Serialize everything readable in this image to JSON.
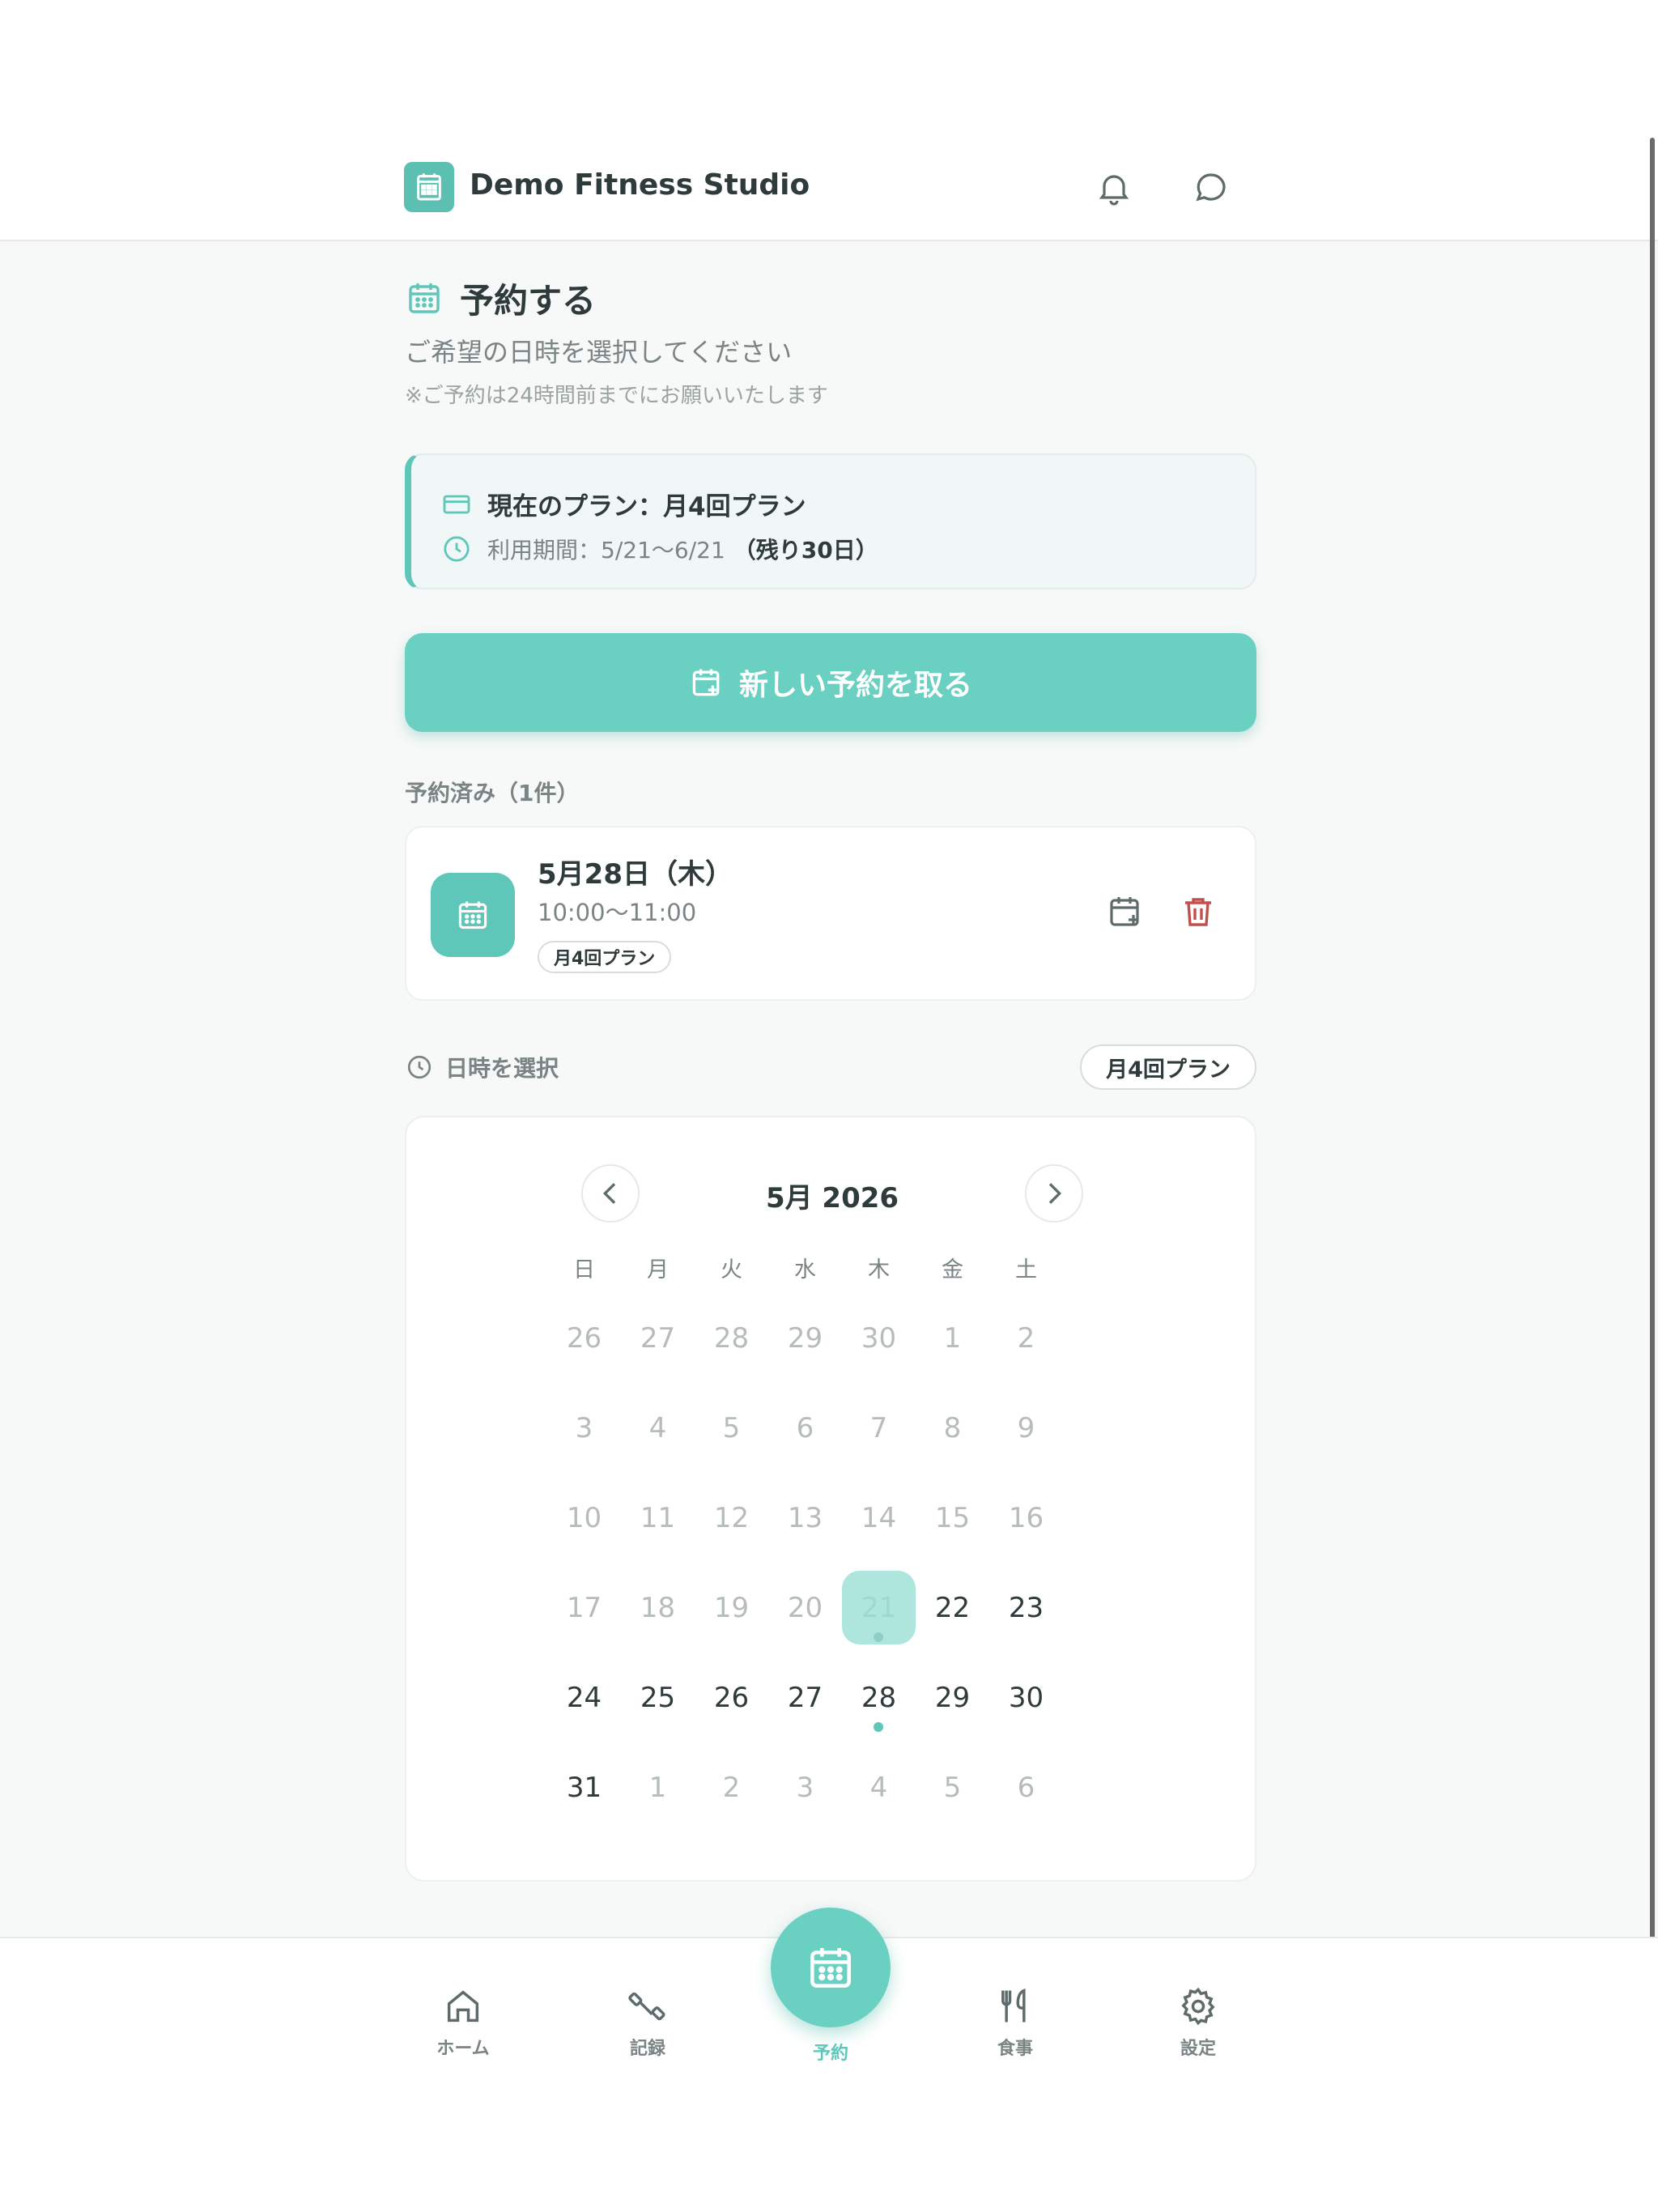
{
  "header": {
    "brand": "Demo Fitness Studio",
    "icons": [
      "bell-icon",
      "chat-icon"
    ]
  },
  "page": {
    "title": "予約する",
    "subtitle": "ご希望の日時を選択してください",
    "note": "※ご予約は24時間前までにお願いいたします"
  },
  "plan": {
    "name": "現在のプラン：月4回プラン",
    "period": "利用期間：5/21〜6/21",
    "remaining": "（残り30日）"
  },
  "new_booking_label": "新しい予約を取る",
  "booked": {
    "section_label": "予約済み（1件）",
    "items": [
      {
        "date": "5月28日（木）",
        "time": "10:00〜11:00",
        "plan": "月4回プラン"
      }
    ]
  },
  "datetime": {
    "label": "日時を選択",
    "plan_pill": "月4回プラン"
  },
  "calendar": {
    "title": "5月 2026",
    "weekdays": [
      "日",
      "月",
      "火",
      "水",
      "木",
      "金",
      "土"
    ],
    "weeks": [
      [
        "26",
        "27",
        "28",
        "29",
        "30",
        "1",
        "2"
      ],
      [
        "3",
        "4",
        "5",
        "6",
        "7",
        "8",
        "9"
      ],
      [
        "10",
        "11",
        "12",
        "13",
        "14",
        "15",
        "16"
      ],
      [
        "17",
        "18",
        "19",
        "20",
        "21",
        "22",
        "23"
      ],
      [
        "24",
        "25",
        "26",
        "27",
        "28",
        "29",
        "30"
      ],
      [
        "31",
        "1",
        "2",
        "3",
        "4",
        "5",
        "6"
      ]
    ],
    "today": "21",
    "booked_day": "28"
  },
  "nav": {
    "home": "ホーム",
    "records": "記録",
    "booking": "予約",
    "meals": "食事",
    "settings": "設定"
  },
  "colors": {
    "accent": "#6ad0c2",
    "accent_dark": "#5ec7b9",
    "danger": "#c0504d"
  }
}
